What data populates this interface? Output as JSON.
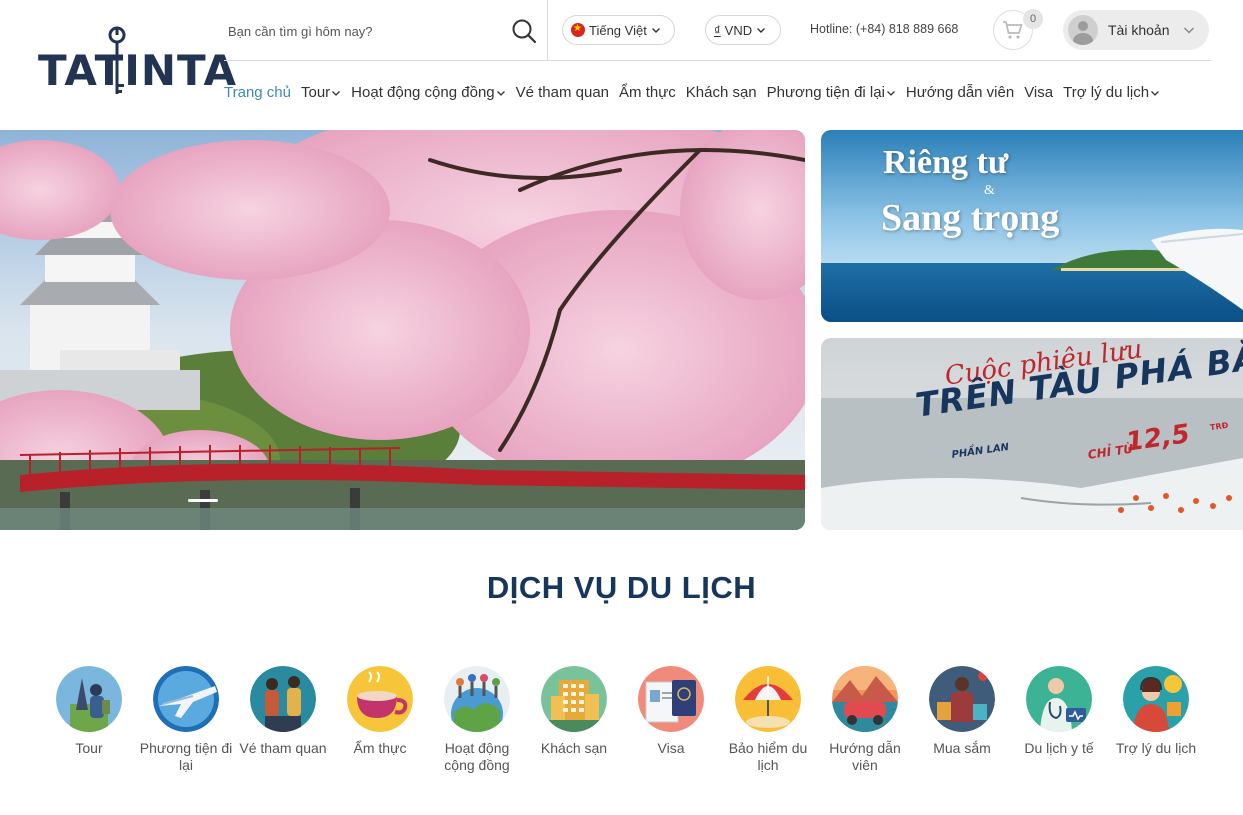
{
  "brand": {
    "logo_text": "TATINTA"
  },
  "search": {
    "placeholder": "Bạn cần tìm gì hôm nay?"
  },
  "language": {
    "selected": "Tiếng Việt"
  },
  "currency": {
    "symbol": "₫",
    "selected": "VND"
  },
  "hotline": "Hotline: (+84) 818 889 668",
  "cart": {
    "count": "0"
  },
  "account": {
    "label": "Tài khoản"
  },
  "nav": {
    "items": [
      {
        "label": "Trang chủ",
        "active": true,
        "dropdown": false
      },
      {
        "label": "Tour",
        "active": false,
        "dropdown": true
      },
      {
        "label": "Hoạt động cộng đồng",
        "active": false,
        "dropdown": true
      },
      {
        "label": "Vé tham quan",
        "active": false,
        "dropdown": false
      },
      {
        "label": "Ẩm thực",
        "active": false,
        "dropdown": false
      },
      {
        "label": "Khách sạn",
        "active": false,
        "dropdown": false
      },
      {
        "label": "Phương tiện đi lại",
        "active": false,
        "dropdown": true
      },
      {
        "label": "Hướng dẫn viên",
        "active": false,
        "dropdown": false
      },
      {
        "label": "Visa",
        "active": false,
        "dropdown": false
      },
      {
        "label": "Trợ lý du lịch",
        "active": false,
        "dropdown": true
      }
    ]
  },
  "banners": {
    "banner1": {
      "line1": "Riêng tư",
      "amp": "&",
      "line2": "Sang trọng"
    },
    "banner2": {
      "script": "Cuộc phiêu lưu",
      "title": "TRÊN TÀU PHÁ BĂNG",
      "sub": "PHẦN LAN",
      "price_label": "CHỈ TỪ",
      "price": "12,5",
      "unit": "TRĐ"
    }
  },
  "services": {
    "title": "DỊCH VỤ DU LỊCH",
    "items": [
      {
        "label": "Tour",
        "icon": "tour-icon"
      },
      {
        "label": "Phương tiện đi lại",
        "icon": "airplane-icon"
      },
      {
        "label": "Vé tham quan",
        "icon": "sightseeing-icon"
      },
      {
        "label": "Ẩm thực",
        "icon": "food-icon"
      },
      {
        "label": "Hoạt động cộng đồng",
        "icon": "community-icon"
      },
      {
        "label": "Khách sạn",
        "icon": "hotel-icon"
      },
      {
        "label": "Visa",
        "icon": "passport-icon"
      },
      {
        "label": "Bảo hiểm du lịch",
        "icon": "insurance-icon"
      },
      {
        "label": "Hướng dẫn viên",
        "icon": "guide-icon"
      },
      {
        "label": "Mua sắm",
        "icon": "shopping-icon"
      },
      {
        "label": "Du lịch y tế",
        "icon": "medical-icon"
      },
      {
        "label": "Trợ lý du lịch",
        "icon": "assistant-icon"
      }
    ]
  },
  "colors": {
    "primary": "#17365e",
    "accent": "#3d8ab8",
    "logo": "#233453"
  }
}
